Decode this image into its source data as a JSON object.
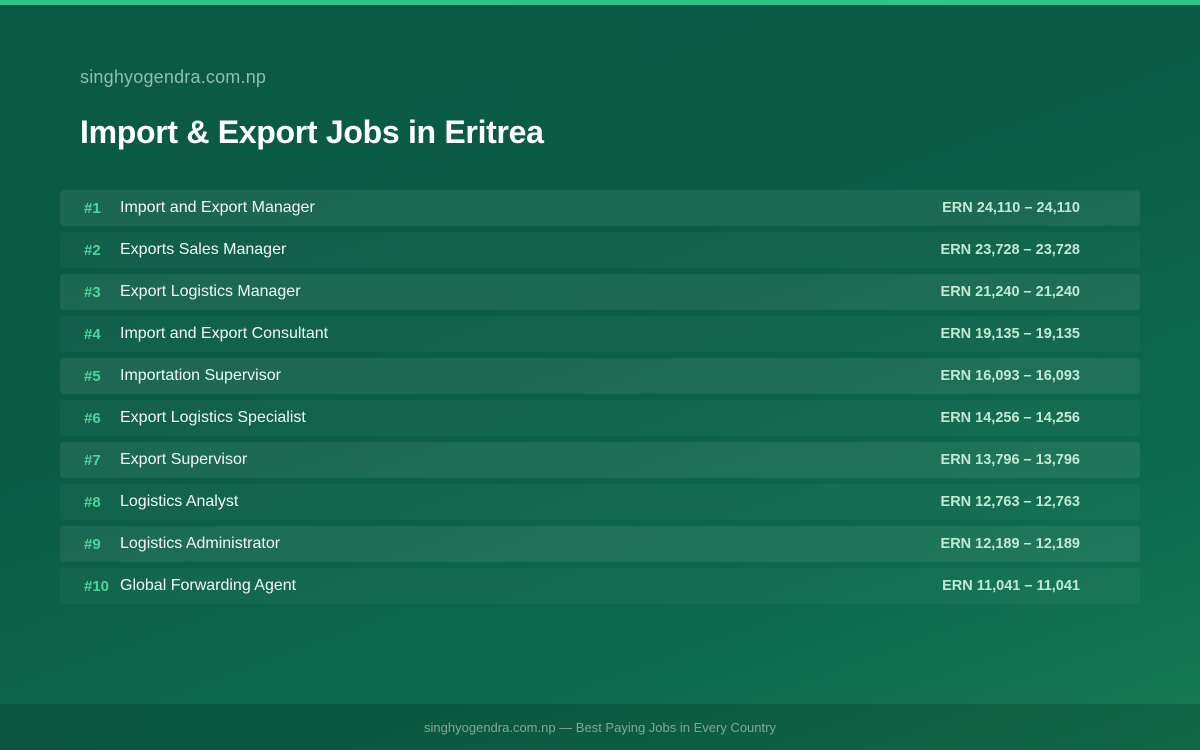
{
  "header": {
    "site": "singhyogendra.com.np",
    "title": "Import & Export Jobs in Eritrea"
  },
  "jobs": [
    {
      "rank": "#1",
      "title": "Import and Export Manager",
      "salary": "ERN 24,110 – 24,110"
    },
    {
      "rank": "#2",
      "title": "Exports Sales Manager",
      "salary": "ERN 23,728 – 23,728"
    },
    {
      "rank": "#3",
      "title": "Export Logistics Manager",
      "salary": "ERN 21,240 – 21,240"
    },
    {
      "rank": "#4",
      "title": "Import and Export Consultant",
      "salary": "ERN 19,135 – 19,135"
    },
    {
      "rank": "#5",
      "title": "Importation Supervisor",
      "salary": "ERN 16,093 – 16,093"
    },
    {
      "rank": "#6",
      "title": "Export Logistics Specialist",
      "salary": "ERN 14,256 – 14,256"
    },
    {
      "rank": "#7",
      "title": "Export Supervisor",
      "salary": "ERN 13,796 – 13,796"
    },
    {
      "rank": "#8",
      "title": "Logistics Analyst",
      "salary": "ERN 12,763 – 12,763"
    },
    {
      "rank": "#9",
      "title": "Logistics Administrator",
      "salary": "ERN 12,189 – 12,189"
    },
    {
      "rank": "#10",
      "title": "Global Forwarding Agent",
      "salary": "ERN 11,041 – 11,041"
    }
  ],
  "footer": {
    "text": "singhyogendra.com.np — Best Paying Jobs in Every Country"
  },
  "colors": {
    "accent": "#2fc387",
    "rank": "#4fd39a",
    "background": "#0b5a44"
  }
}
